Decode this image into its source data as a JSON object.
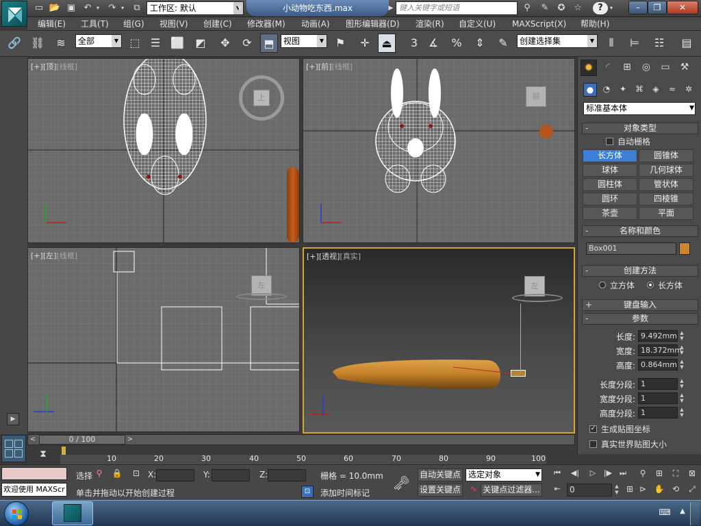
{
  "app": {
    "file_title": "小动物吃东西.max",
    "workspace_label": "工作区: 默认",
    "search_placeholder": "键入关键字或短语"
  },
  "menu": [
    "编辑(E)",
    "工具(T)",
    "组(G)",
    "视图(V)",
    "创建(C)",
    "修改器(M)",
    "动画(A)",
    "图形编辑器(D)",
    "渲染(R)",
    "自定义(U)",
    "MAXScript(X)",
    "帮助(H)"
  ],
  "toolbar": {
    "selection_filter": "全部",
    "ref_coord": "视图",
    "named_selection": "创建选择集",
    "snap_value": "3",
    "percent": "%"
  },
  "viewports": {
    "top": {
      "plus": "[+]",
      "name": "[顶]",
      "mode": "[线框]",
      "cube_label": "上"
    },
    "front": {
      "plus": "[+]",
      "name": "[前]",
      "mode": "[线框]",
      "cube_label": "前"
    },
    "left": {
      "plus": "[+]",
      "name": "[左]",
      "mode": "[线框]",
      "cube_label": "左"
    },
    "persp": {
      "plus": "[+]",
      "name": "[透视]",
      "mode": "[真实]",
      "cube_label": "左"
    }
  },
  "axis": {
    "x": "x",
    "y": "y",
    "z": "z"
  },
  "cmdpanel": {
    "primitive_dropdown": "标准基本体",
    "object_type": {
      "title": "对象类型",
      "auto_grid": "自动栅格",
      "buttons": [
        "长方体",
        "圆锥体",
        "球体",
        "几何球体",
        "圆柱体",
        "管状体",
        "圆环",
        "四棱锥",
        "茶壶",
        "平面"
      ]
    },
    "name_color": {
      "title": "名称和颜色",
      "name": "Box001",
      "color": "#c8862e"
    },
    "creation_method": {
      "title": "创建方法",
      "opt1": "立方体",
      "opt2": "长方体"
    },
    "keyboard_input": {
      "title": "键盘输入"
    },
    "params": {
      "title": "参数",
      "length_label": "长度:",
      "length": "9.492mm",
      "width_label": "宽度:",
      "width": "18.372mm",
      "height_label": "高度:",
      "height": "0.864mm",
      "lseg_label": "长度分段:",
      "lseg": "1",
      "wseg_label": "宽度分段:",
      "wseg": "1",
      "hseg_label": "高度分段:",
      "hseg": "1",
      "gen_map": "生成贴图坐标",
      "real_world": "真实世界贴图大小"
    }
  },
  "timeline": {
    "frame": "0 / 100",
    "ticks": [
      "10",
      "20",
      "30",
      "40",
      "50",
      "60",
      "70",
      "80",
      "90",
      "100"
    ]
  },
  "status": {
    "maxscript_welcome": "欢迎使用 MAXScr",
    "sel_label": "选择",
    "x_label": "X:",
    "y_label": "Y:",
    "z_label": "Z:",
    "grid": "栅格 = 10.0mm",
    "prompt": "单击并拖动以开始创建过程",
    "add_time_tag": "添加时间标记",
    "auto_key": "自动关键点",
    "set_key": "设置关键点",
    "selected_object": "选定对象",
    "key_filters": "关键点过滤器...",
    "frame_value": "0"
  }
}
